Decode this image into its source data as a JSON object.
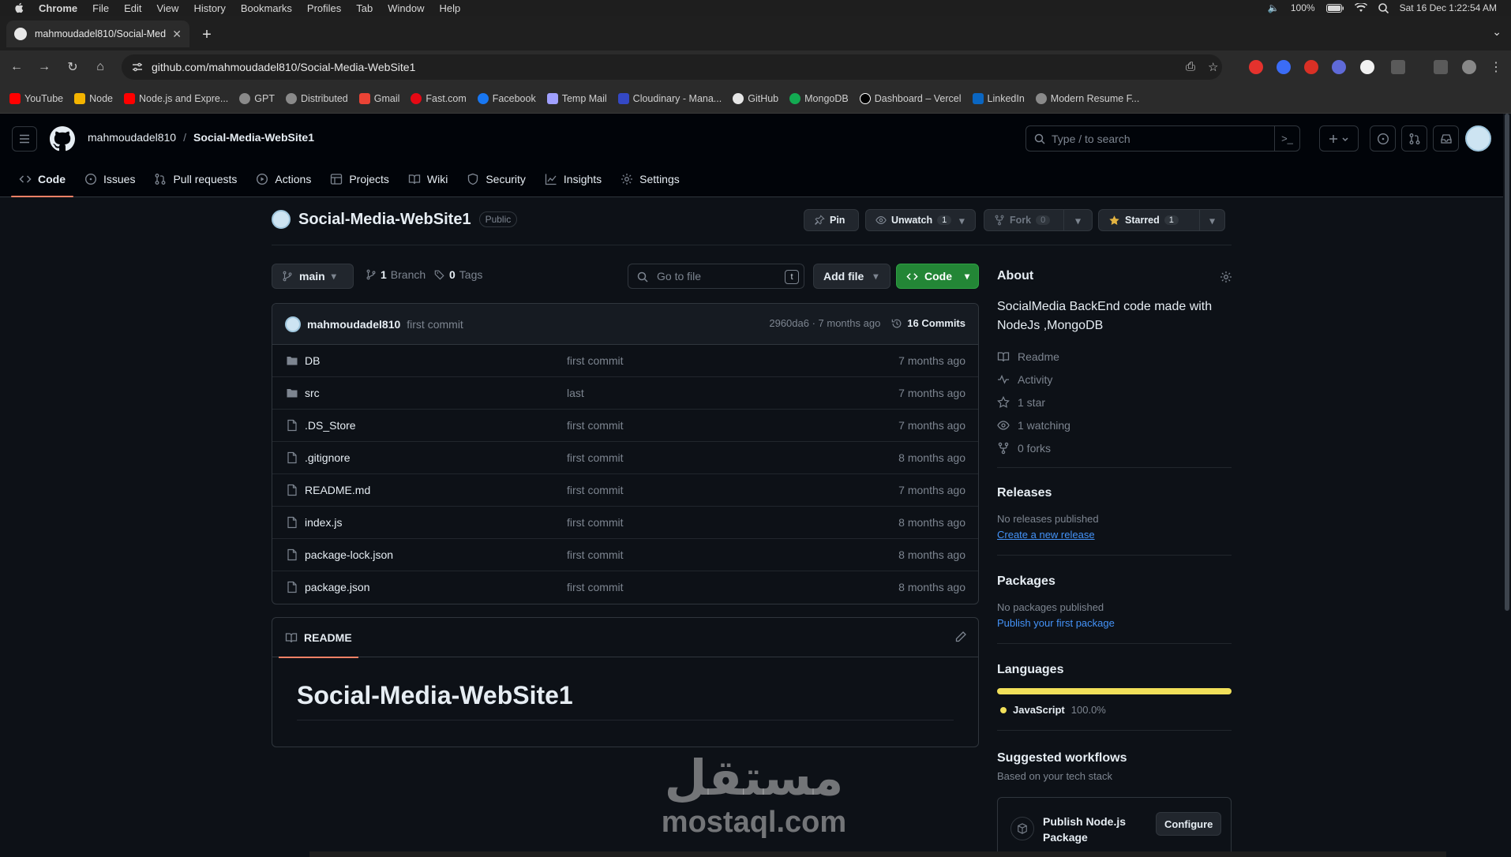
{
  "mac_menu": {
    "app": "Chrome",
    "items": [
      "File",
      "Edit",
      "View",
      "History",
      "Bookmarks",
      "Profiles",
      "Tab",
      "Window",
      "Help"
    ],
    "battery": "100%",
    "datetime": "Sat 16 Dec  1:22:54 AM"
  },
  "browser": {
    "tab_title": "mahmoudadel810/Social-Med",
    "url": "github.com/mahmoudadel810/Social-Media-WebSite1",
    "bookmarks": [
      {
        "label": "YouTube",
        "color": "#ff0000"
      },
      {
        "label": "Node",
        "color": "#f4b400"
      },
      {
        "label": "Node.js and Expre...",
        "color": "#ff0000"
      },
      {
        "label": "GPT",
        "color": "#cfcfcf"
      },
      {
        "label": "Distributed",
        "color": "#cfcfcf"
      },
      {
        "label": "Gmail",
        "color": "#ea4335"
      },
      {
        "label": "Fast.com",
        "color": "#e50914"
      },
      {
        "label": "Facebook",
        "color": "#1877f2"
      },
      {
        "label": "Temp Mail",
        "color": "#a0a0ff"
      },
      {
        "label": "Cloudinary - Mana...",
        "color": "#3448c5"
      },
      {
        "label": "GitHub",
        "color": "#e6e6e6"
      },
      {
        "label": "MongoDB",
        "color": "#13aa52"
      },
      {
        "label": "Dashboard – Vercel",
        "color": "#000000"
      },
      {
        "label": "LinkedIn",
        "color": "#0a66c2"
      },
      {
        "label": "Modern Resume F...",
        "color": "#cfcfcf"
      }
    ]
  },
  "header": {
    "owner": "mahmoudadel810",
    "separator": "/",
    "repo": "Social-Media-WebSite1",
    "search_placeholder": "Type / to search"
  },
  "repo_nav": [
    "Code",
    "Issues",
    "Pull requests",
    "Actions",
    "Projects",
    "Wiki",
    "Security",
    "Insights",
    "Settings"
  ],
  "repo": {
    "name": "Social-Media-WebSite1",
    "visibility": "Public",
    "pin_label": "Pin",
    "watch_label": "Unwatch",
    "watch_count": "1",
    "fork_label": "Fork",
    "fork_count": "0",
    "star_label": "Starred",
    "star_count": "1"
  },
  "file_toolbar": {
    "branch": "main",
    "branch_count": "1",
    "branch_label": "Branch",
    "tag_count": "0",
    "tag_label": "Tags",
    "goto_placeholder": "Go to file",
    "goto_key": "t",
    "add_file": "Add file",
    "code": "Code"
  },
  "latest_commit": {
    "author": "mahmoudadel810",
    "message": "first commit",
    "hash_time": "2960da6 · 7 months ago",
    "commits_count": "16 Commits"
  },
  "files": [
    {
      "type": "dir",
      "name": "DB",
      "message": "first commit",
      "time": "7 months ago"
    },
    {
      "type": "dir",
      "name": "src",
      "message": "last",
      "time": "7 months ago"
    },
    {
      "type": "file",
      "name": ".DS_Store",
      "message": "first commit",
      "time": "7 months ago"
    },
    {
      "type": "file",
      "name": ".gitignore",
      "message": "first commit",
      "time": "8 months ago"
    },
    {
      "type": "file",
      "name": "README.md",
      "message": "first commit",
      "time": "7 months ago"
    },
    {
      "type": "file",
      "name": "index.js",
      "message": "first commit",
      "time": "8 months ago"
    },
    {
      "type": "file",
      "name": "package-lock.json",
      "message": "first commit",
      "time": "8 months ago"
    },
    {
      "type": "file",
      "name": "package.json",
      "message": "first commit",
      "time": "8 months ago"
    }
  ],
  "readme": {
    "tab": "README",
    "heading": "Social-Media-WebSite1"
  },
  "about": {
    "title": "About",
    "description": "SocialMedia BackEnd code made with NodeJs ,MongoDB",
    "readme": "Readme",
    "activity": "Activity",
    "stars": "1 star",
    "watching": "1 watching",
    "forks": "0 forks"
  },
  "releases": {
    "title": "Releases",
    "status": "No releases published",
    "link": "Create a new release"
  },
  "packages": {
    "title": "Packages",
    "status": "No packages published",
    "link": "Publish your first package"
  },
  "languages": {
    "title": "Languages",
    "items": [
      {
        "name": "JavaScript",
        "percent": "100.0%",
        "color": "#f1e05a"
      }
    ]
  },
  "workflows": {
    "title": "Suggested workflows",
    "subtitle": "Based on your tech stack",
    "card_name": "Publish Node.js Package",
    "configure": "Configure"
  },
  "watermark": {
    "arabic": "مستقل",
    "latin": "mostaql.com"
  }
}
